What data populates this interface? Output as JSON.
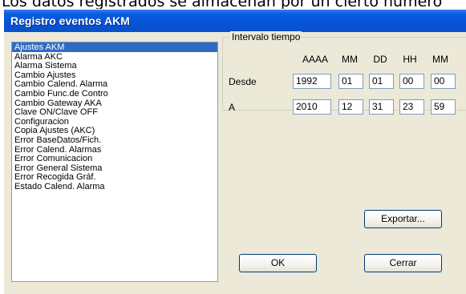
{
  "page_caption": "Los datos registrados se almacenan por un cierto número",
  "dialog": {
    "title": "Registro eventos AKM"
  },
  "events_list": {
    "items": [
      {
        "label": "Ajustes AKM",
        "selected": true
      },
      {
        "label": "Alarma AKC",
        "selected": false
      },
      {
        "label": "Alarma Sistema",
        "selected": false
      },
      {
        "label": "Cambio Ajustes",
        "selected": false
      },
      {
        "label": "Cambio Calend. Alarma",
        "selected": false
      },
      {
        "label": "Cambio Func.de Contro",
        "selected": false
      },
      {
        "label": "Cambio Gateway AKA",
        "selected": false
      },
      {
        "label": "Clave ON/Clave OFF",
        "selected": false
      },
      {
        "label": "Configuracion",
        "selected": false
      },
      {
        "label": "Copia Ajustes (AKC)",
        "selected": false
      },
      {
        "label": "Error BaseDatos/Fich.",
        "selected": false
      },
      {
        "label": "Error Calend. Alarmas",
        "selected": false
      },
      {
        "label": "Error Comunicacion",
        "selected": false
      },
      {
        "label": "Error General Sistema",
        "selected": false
      },
      {
        "label": "Error Recogida Gráf.",
        "selected": false
      },
      {
        "label": "Estado Calend. Alarma",
        "selected": false
      }
    ]
  },
  "interval": {
    "legend": "Intervalo tiempo",
    "headers": [
      "AAAA",
      "MM",
      "DD",
      "HH",
      "MM"
    ],
    "rows": [
      {
        "label": "Desde",
        "values": [
          "1992",
          "01",
          "01",
          "00",
          "00"
        ]
      },
      {
        "label": "A",
        "values": [
          "2010",
          "12",
          "31",
          "23",
          "59"
        ]
      }
    ]
  },
  "buttons": {
    "export": "Exportar...",
    "ok": "OK",
    "close": "Cerrar"
  },
  "colors": {
    "titlebar": "#0554d8",
    "selection": "#316ac5",
    "dialog_bg": "#ece9d8"
  }
}
